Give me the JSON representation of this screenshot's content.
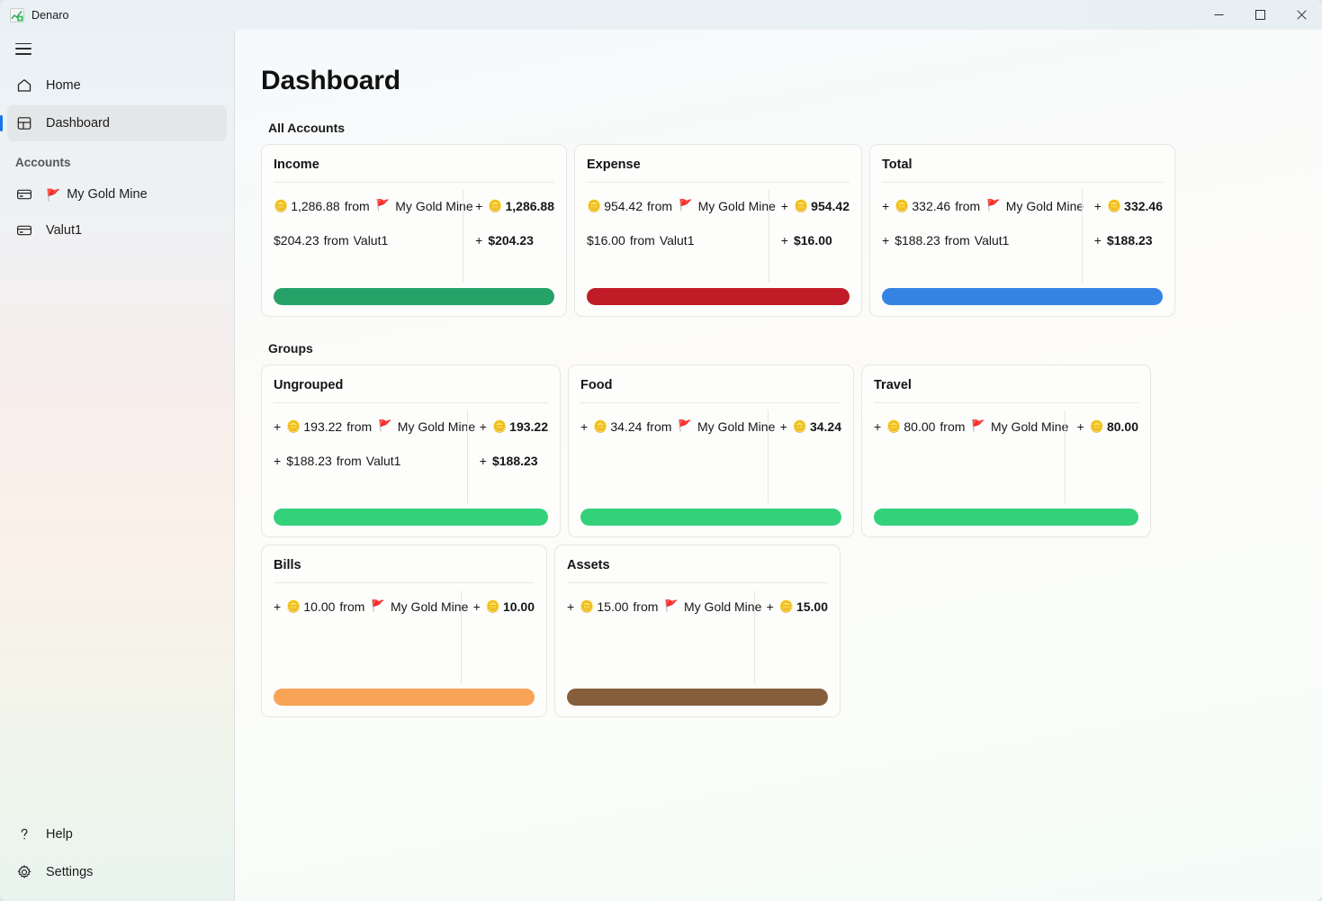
{
  "window": {
    "title": "Denaro",
    "app_icon": "chart-app-icon",
    "controls": {
      "minimize": "minimize-icon",
      "maximize": "maximize-icon",
      "close": "close-icon"
    }
  },
  "sidebar": {
    "menu_button": "hamburger-icon",
    "nav": [
      {
        "label": "Home",
        "icon": "home-icon",
        "selected": false
      },
      {
        "label": "Dashboard",
        "icon": "dashboard-icon",
        "selected": true
      }
    ],
    "accounts_header": "Accounts",
    "accounts": [
      {
        "label": "My Gold Mine",
        "icon": "card-icon",
        "flag": "🚩"
      },
      {
        "label": "Valut1",
        "icon": "card-icon",
        "flag": ""
      }
    ],
    "bottom": [
      {
        "label": "Help",
        "icon": "question-icon"
      },
      {
        "label": "Settings",
        "icon": "gear-icon"
      }
    ]
  },
  "main": {
    "page_title": "Dashboard",
    "sections": [
      {
        "id": "all-accounts",
        "title": "All Accounts"
      },
      {
        "id": "groups",
        "title": "Groups"
      }
    ]
  },
  "colors": {
    "income_bar": "#26a269",
    "expense_bar": "#c01c28",
    "total_bar": "#3584e4",
    "group_green": "#33d17a",
    "bills_orange": "#f8a355",
    "assets_brown": "#865e3c",
    "accent": "#1a73e8",
    "flag_purple": "#5b4b9e"
  },
  "all_accounts": [
    {
      "title": "Income",
      "bar_color": "#26a269",
      "rows": [
        {
          "sign": "",
          "coin": "🪙",
          "amount": "1,286.88",
          "from": "from",
          "flag": "🚩",
          "account": "My Gold Mine"
        },
        {
          "sign": "",
          "coin": "",
          "amount": "$204.23",
          "from": "from",
          "flag": "",
          "account": "Valut1"
        }
      ],
      "totals": [
        {
          "sign": "+",
          "coin": "🪙",
          "amount": "1,286.88"
        },
        {
          "sign": "+",
          "coin": "",
          "amount": "$204.23"
        }
      ]
    },
    {
      "title": "Expense",
      "bar_color": "#c01c28",
      "rows": [
        {
          "sign": "",
          "coin": "🪙",
          "amount": "954.42",
          "from": "from",
          "flag": "🚩",
          "account": "My Gold Mine"
        },
        {
          "sign": "",
          "coin": "",
          "amount": "$16.00",
          "from": "from",
          "flag": "",
          "account": "Valut1"
        }
      ],
      "totals": [
        {
          "sign": "+",
          "coin": "🪙",
          "amount": "954.42"
        },
        {
          "sign": "+",
          "coin": "",
          "amount": "$16.00"
        }
      ]
    },
    {
      "title": "Total",
      "bar_color": "#3584e4",
      "rows": [
        {
          "sign": "+",
          "coin": "🪙",
          "amount": "332.46",
          "from": "from",
          "flag": "🚩",
          "account": "My Gold Mine"
        },
        {
          "sign": "+",
          "coin": "",
          "amount": "$188.23",
          "from": "from",
          "flag": "",
          "account": "Valut1"
        }
      ],
      "totals": [
        {
          "sign": "+",
          "coin": "🪙",
          "amount": "332.46"
        },
        {
          "sign": "+",
          "coin": "",
          "amount": "$188.23"
        }
      ]
    }
  ],
  "groups": [
    {
      "title": "Ungrouped",
      "bar_color": "#33d17a",
      "rows": [
        {
          "sign": "+",
          "coin": "🪙",
          "amount": "193.22",
          "from": "from",
          "flag": "🚩",
          "account": "My Gold Mine"
        },
        {
          "sign": "+",
          "coin": "",
          "amount": "$188.23",
          "from": "from",
          "flag": "",
          "account": "Valut1"
        }
      ],
      "totals": [
        {
          "sign": "+",
          "coin": "🪙",
          "amount": "193.22"
        },
        {
          "sign": "+",
          "coin": "",
          "amount": "$188.23"
        }
      ]
    },
    {
      "title": "Food",
      "bar_color": "#33d17a",
      "rows": [
        {
          "sign": "+",
          "coin": "🪙",
          "amount": "34.24",
          "from": "from",
          "flag": "🚩",
          "account": "My Gold Mine"
        }
      ],
      "totals": [
        {
          "sign": "+",
          "coin": "🪙",
          "amount": "34.24"
        }
      ]
    },
    {
      "title": "Travel",
      "bar_color": "#33d17a",
      "rows": [
        {
          "sign": "+",
          "coin": "🪙",
          "amount": "80.00",
          "from": "from",
          "flag": "🚩",
          "account": "My Gold Mine"
        }
      ],
      "totals": [
        {
          "sign": "+",
          "coin": "🪙",
          "amount": "80.00"
        }
      ]
    },
    {
      "title": "Bills",
      "bar_color": "#f8a355",
      "rows": [
        {
          "sign": "+",
          "coin": "🪙",
          "amount": "10.00",
          "from": "from",
          "flag": "🚩",
          "account": "My Gold Mine"
        }
      ],
      "totals": [
        {
          "sign": "+",
          "coin": "🪙",
          "amount": "10.00"
        }
      ]
    },
    {
      "title": "Assets",
      "bar_color": "#865e3c",
      "rows": [
        {
          "sign": "+",
          "coin": "🪙",
          "amount": "15.00",
          "from": "from",
          "flag": "🚩",
          "account": "My Gold Mine"
        }
      ],
      "totals": [
        {
          "sign": "+",
          "coin": "🪙",
          "amount": "15.00"
        }
      ]
    }
  ]
}
